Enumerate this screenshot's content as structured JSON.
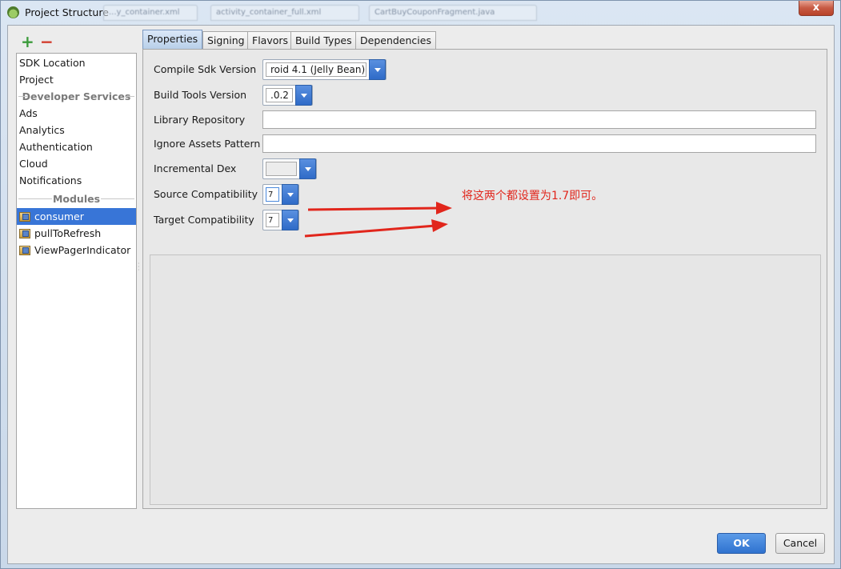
{
  "window": {
    "title": "Project Structure",
    "close_glyph": "x",
    "background_tabs": [
      "...y_container.xml",
      "activity_container_full.xml",
      "CartBuyCouponFragment.java"
    ]
  },
  "toolbar": {
    "add_glyph": "+",
    "remove_glyph": "−"
  },
  "sidebar": {
    "top_items": [
      "SDK Location",
      "Project"
    ],
    "developer_services_header": "Developer Services",
    "developer_services": [
      "Ads",
      "Analytics",
      "Authentication",
      "Cloud",
      "Notifications"
    ],
    "modules_header": "Modules",
    "modules": [
      {
        "label": "consumer",
        "selected": true
      },
      {
        "label": "pullToRefresh",
        "selected": false
      },
      {
        "label": "ViewPagerIndicator",
        "selected": false
      }
    ]
  },
  "tabs": [
    {
      "label": "Properties",
      "active": true
    },
    {
      "label": "Signing",
      "active": false
    },
    {
      "label": "Flavors",
      "active": false
    },
    {
      "label": "Build Types",
      "active": false
    },
    {
      "label": "Dependencies",
      "active": false
    }
  ],
  "form": {
    "compile_sdk": {
      "label": "Compile Sdk Version",
      "value": "roid 4.1 (Jelly Bean)"
    },
    "build_tools": {
      "label": "Build Tools Version",
      "value": ".0.2"
    },
    "library_repository": {
      "label": "Library Repository",
      "value": ""
    },
    "ignore_assets": {
      "label": "Ignore Assets Pattern",
      "value": ""
    },
    "incremental_dex": {
      "label": "Incremental Dex",
      "value": ""
    },
    "source_compat": {
      "label": "Source Compatibility",
      "value": "7"
    },
    "target_compat": {
      "label": "Target Compatibility",
      "value": "7"
    }
  },
  "annotation": {
    "text": "将这两个都设置为1.7即可。",
    "color": "#e1261c"
  },
  "buttons": {
    "ok": "OK",
    "cancel": "Cancel"
  },
  "colors": {
    "accent": "#3875d7",
    "selection": "#3875d7",
    "annotation": "#e1261c"
  }
}
